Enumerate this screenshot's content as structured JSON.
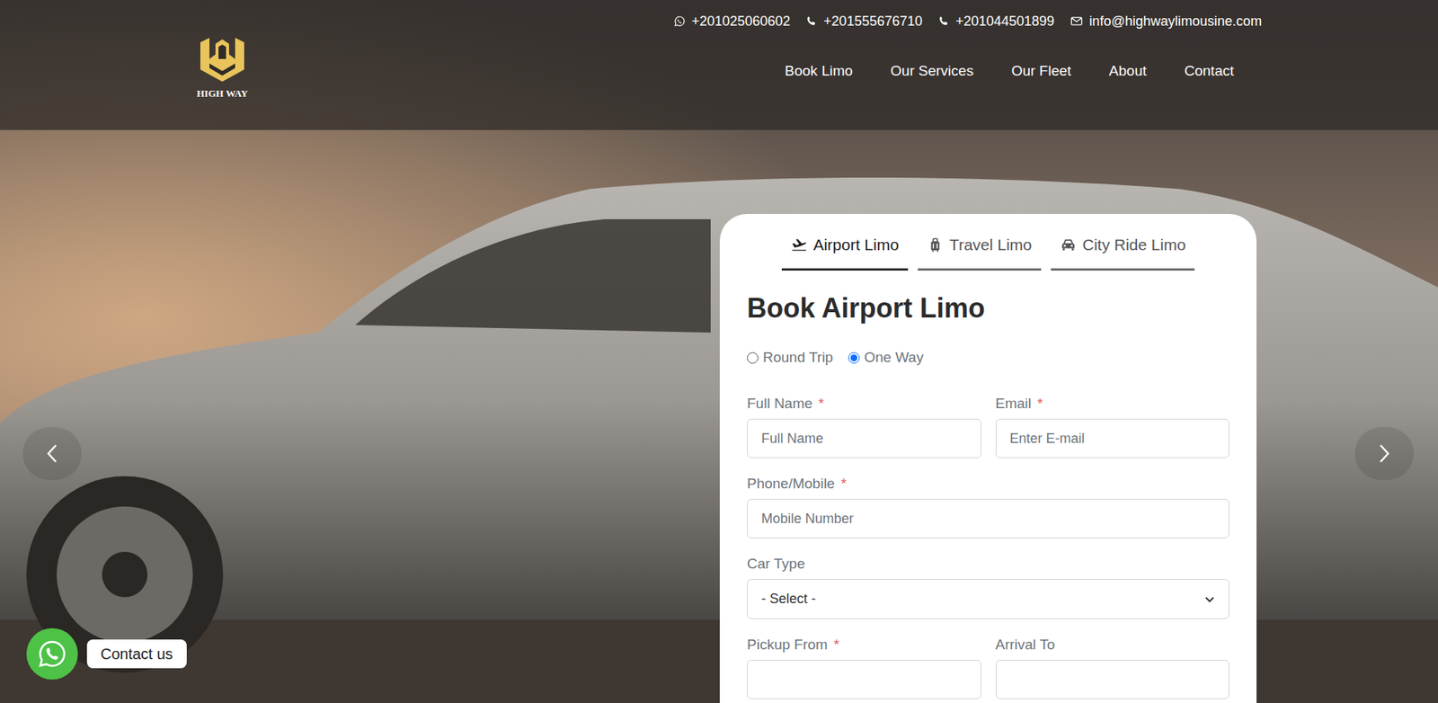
{
  "contact_bar": [
    {
      "kind": "whatsapp",
      "text": "+201025060602"
    },
    {
      "kind": "phone",
      "text": "+201555676710"
    },
    {
      "kind": "phone",
      "text": "+201044501899"
    },
    {
      "kind": "email",
      "text": "info@highwaylimousine.com"
    }
  ],
  "logo": {
    "name": "HIGH WAY"
  },
  "nav": [
    "Book Limo",
    "Our Services",
    "Our Fleet",
    "About",
    "Contact"
  ],
  "tabs": [
    {
      "label": "Airport Limo",
      "kind": "plane",
      "selected": true
    },
    {
      "label": "Travel Limo",
      "kind": "suitcase",
      "selected": false
    },
    {
      "label": "City Ride Limo",
      "kind": "car",
      "selected": false
    }
  ],
  "form": {
    "title": "Book Airport Limo",
    "required_mark": "*",
    "trip_types": [
      {
        "label": "Round Trip",
        "selected": false
      },
      {
        "label": "One Way",
        "selected": true
      }
    ],
    "rows": [
      [
        {
          "label": "Full Name",
          "required": true,
          "kind": "input",
          "placeholder": "Full Name"
        },
        {
          "label": "Email",
          "required": true,
          "kind": "input",
          "placeholder": "Enter E-mail"
        }
      ],
      [
        {
          "label": "Phone/Mobile",
          "required": true,
          "kind": "input",
          "placeholder": "Mobile Number"
        }
      ],
      [
        {
          "label": "Car Type",
          "required": false,
          "kind": "select",
          "value": "- Select -"
        }
      ],
      [
        {
          "label": "Pickup From",
          "required": true,
          "kind": "input",
          "placeholder": ""
        },
        {
          "label": "Arrival To",
          "required": false,
          "kind": "input",
          "placeholder": ""
        }
      ]
    ]
  },
  "whatsapp_button": {
    "label": "Contact us"
  }
}
